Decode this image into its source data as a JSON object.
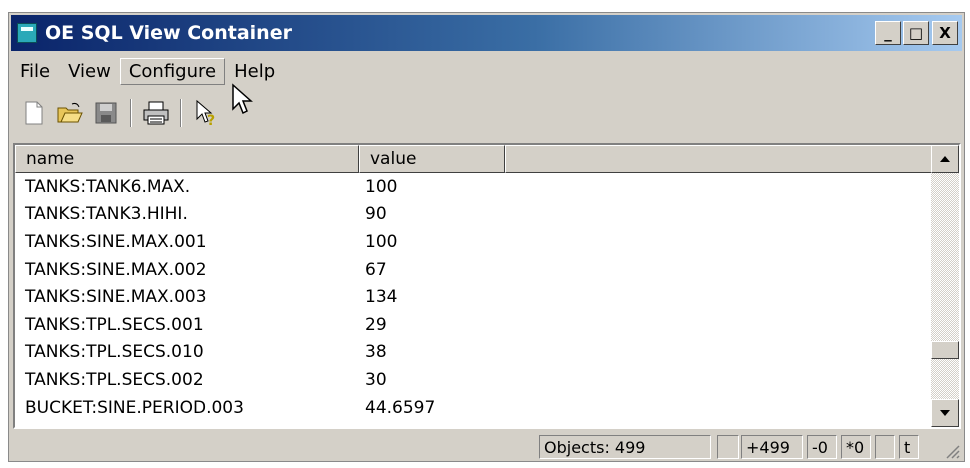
{
  "window": {
    "title": "OE SQL View Container"
  },
  "title_buttons": {
    "minimize": "_",
    "maximize": "□",
    "close": "X"
  },
  "menu": [
    "File",
    "View",
    "Configure",
    "Help"
  ],
  "toolbar": [
    "new-icon",
    "open-icon",
    "save-icon",
    "print-icon",
    "context-help-icon"
  ],
  "grid": {
    "headers": [
      "name",
      "value"
    ],
    "rows": [
      [
        "TANKS:TANK6.MAX.",
        "100"
      ],
      [
        "TANKS:TANK3.HIHI.",
        "90"
      ],
      [
        "TANKS:SINE.MAX.001",
        "100"
      ],
      [
        "TANKS:SINE.MAX.002",
        "67"
      ],
      [
        "TANKS:SINE.MAX.003",
        "134"
      ],
      [
        "TANKS:TPL.SECS.001",
        "29"
      ],
      [
        "TANKS:TPL.SECS.010",
        "38"
      ],
      [
        "TANKS:TPL.SECS.002",
        "30"
      ],
      [
        "BUCKET:SINE.PERIOD.003",
        "44.6597"
      ]
    ]
  },
  "status": {
    "objects": "Objects: 499",
    "added": "+499",
    "removed": "-0",
    "changed": "*0",
    "extra": "t"
  },
  "colors": {
    "title_start": "#0a246a",
    "title_end": "#a6caf0",
    "face": "#d4d0c8"
  }
}
